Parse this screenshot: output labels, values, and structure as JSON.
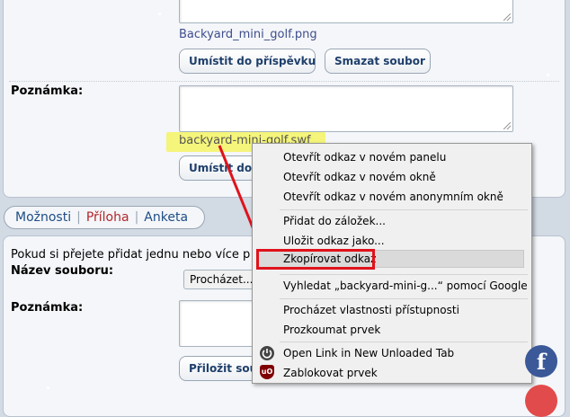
{
  "attachment1": {
    "filename": "Backyard_mini_golf.png",
    "insert_button": "Umístit do příspěvku",
    "delete_button": "Smazat soubor"
  },
  "note_label": "Poznámka:",
  "attachment2": {
    "filename": "backyard-mini-golf.swf",
    "insert_button_visible": "Umístit do"
  },
  "tabs": [
    "Možnosti",
    "Příloha",
    "Anketa"
  ],
  "active_tab": "Příloha",
  "upload": {
    "intro_text": "Pokud si přejete přidat jednu nebo více p",
    "filename_label": "Název souboru:",
    "browse_button": "Procházet...",
    "note_label": "Poznámka:",
    "attach_button": "Přiložit sou"
  },
  "context_menu": {
    "items": [
      {
        "label": "Otevřít odkaz v novém panelu"
      },
      {
        "label": "Otevřít odkaz v novém okně"
      },
      {
        "label": "Otevřít odkaz v novém anonymním okně"
      },
      {
        "label": "Přidat do záložek..."
      },
      {
        "label": "Uložit odkaz jako..."
      },
      {
        "label": "Zkopírovat odkaz",
        "highlighted": true
      },
      {
        "label": "Vyhledat „backyard-mini-g...“ pomocí Google"
      },
      {
        "label": "Procházet vlastnosti přístupnosti"
      },
      {
        "label": "Prozkoumat prvek"
      },
      {
        "label": "Open Link in New Unloaded Tab",
        "icon": "power-icon"
      },
      {
        "label": "Zablokovat prvek",
        "icon": "ublock-shield-icon"
      }
    ],
    "highlight_color": "#e0121b"
  },
  "annotation_arrow_color": "#e0121b",
  "highlight_color": "#f4f57a",
  "social": {
    "facebook_glyph": "f",
    "facebook_color": "#3b5998"
  }
}
